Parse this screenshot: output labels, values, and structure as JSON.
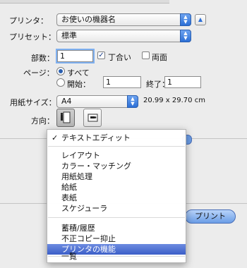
{
  "printer": {
    "label": "プリンタ：",
    "value": "お使いの機器名"
  },
  "preset": {
    "label": "プリセット：",
    "value": "標準"
  },
  "copies": {
    "label": "部数：",
    "value": "1",
    "collate_label": "丁合い",
    "duplex_label": "両面"
  },
  "pages": {
    "label": "ページ：",
    "all_label": "すべて",
    "from_label": "開始：",
    "from_value": "1",
    "to_label": "終了：",
    "to_value": "1"
  },
  "paper": {
    "label": "用紙サイズ：",
    "value": "A4",
    "dimensions": "20.99 x 29.70 cm"
  },
  "orientation": {
    "label": "方向："
  },
  "print_button": "プリント",
  "menu": {
    "items": [
      {
        "label": "テキストエディット",
        "checked": true
      },
      {
        "label": "レイアウト"
      },
      {
        "label": "カラー・マッチング"
      },
      {
        "label": "用紙処理"
      },
      {
        "label": "給紙"
      },
      {
        "label": "表紙"
      },
      {
        "label": "スケジューラ"
      },
      {
        "label": "蓄積/履歴"
      },
      {
        "label": "不正コピー抑止"
      },
      {
        "label": "プリンタの機能",
        "highlighted": true
      },
      {
        "label": "一覧"
      }
    ]
  },
  "colors": {
    "accent": "#3b5ec8",
    "popup_arrow": "#2c6fd6"
  }
}
